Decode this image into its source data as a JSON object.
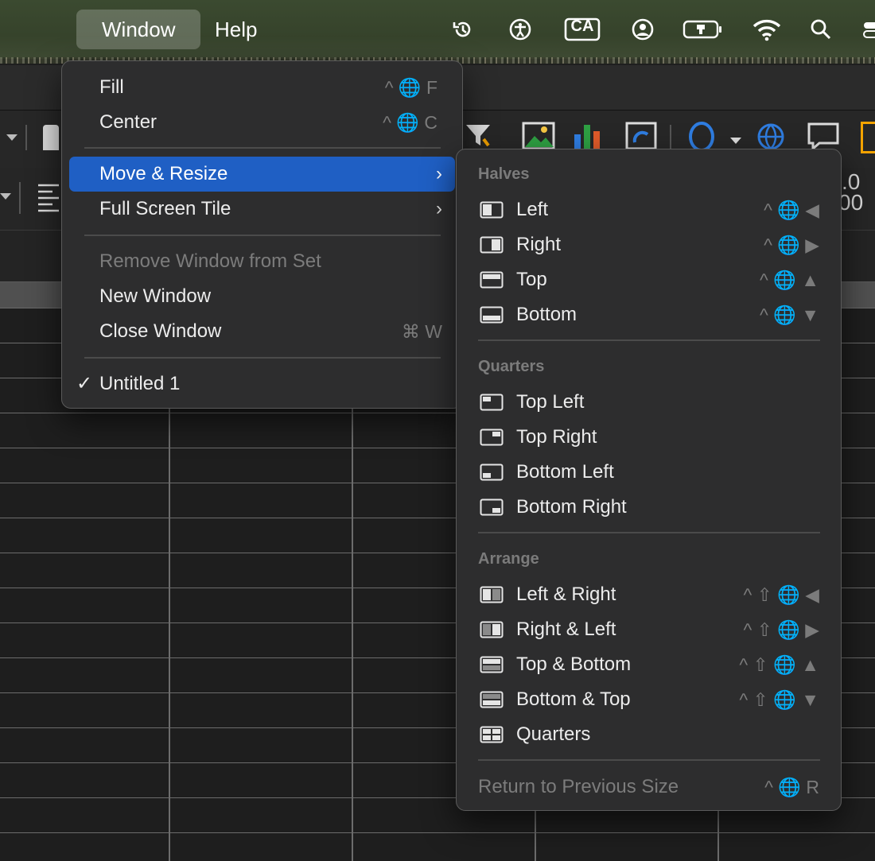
{
  "menubar": {
    "items": [
      {
        "label": "Window",
        "active": true
      },
      {
        "label": "Help",
        "active": false
      }
    ],
    "status_icons": [
      "time-machine-icon",
      "accessibility-icon",
      "input-source-icon",
      "user-account-icon",
      "battery-charging-icon",
      "wifi-icon",
      "spotlight-search-icon",
      "control-center-icon"
    ],
    "input_source_label": "CA"
  },
  "window_menu": {
    "items": [
      {
        "label": "Fill",
        "shortcut": "^ 🌐 F",
        "disabled": false
      },
      {
        "label": "Center",
        "shortcut": "^ 🌐 C",
        "disabled": false
      },
      {
        "label": "Move & Resize",
        "submenu": true,
        "highlighted": true
      },
      {
        "label": "Full Screen Tile",
        "submenu": true
      },
      {
        "label": "Remove Window from Set",
        "disabled": true
      },
      {
        "label": "New Window",
        "disabled": false
      },
      {
        "label": "Close Window",
        "shortcut": "⌘ W",
        "disabled": false
      },
      {
        "label": "Untitled 1",
        "checked": true
      }
    ],
    "submenu_chevron": "›",
    "check_mark": "✓"
  },
  "move_resize_menu": {
    "halves_title": "Halves",
    "halves": [
      {
        "label": "Left",
        "shortcut": "^ 🌐 ◀",
        "icon": "window-left-half-icon"
      },
      {
        "label": "Right",
        "shortcut": "^ 🌐 ▶",
        "icon": "window-right-half-icon"
      },
      {
        "label": "Top",
        "shortcut": "^ 🌐 ▲",
        "icon": "window-top-half-icon"
      },
      {
        "label": "Bottom",
        "shortcut": "^ 🌐 ▼",
        "icon": "window-bottom-half-icon"
      }
    ],
    "quarters_title": "Quarters",
    "quarters": [
      {
        "label": "Top Left",
        "icon": "window-top-left-icon"
      },
      {
        "label": "Top Right",
        "icon": "window-top-right-icon"
      },
      {
        "label": "Bottom Left",
        "icon": "window-bottom-left-icon"
      },
      {
        "label": "Bottom Right",
        "icon": "window-bottom-right-icon"
      }
    ],
    "arrange_title": "Arrange",
    "arrange": [
      {
        "label": "Left & Right",
        "shortcut": "^ ⇧ 🌐 ◀",
        "icon": "arrange-left-right-icon"
      },
      {
        "label": "Right & Left",
        "shortcut": "^ ⇧ 🌐 ▶",
        "icon": "arrange-right-left-icon"
      },
      {
        "label": "Top & Bottom",
        "shortcut": "^ ⇧ 🌐 ▲",
        "icon": "arrange-top-bottom-icon"
      },
      {
        "label": "Bottom & Top",
        "shortcut": "^ ⇧ 🌐 ▼",
        "icon": "arrange-bottom-top-icon"
      },
      {
        "label": "Quarters",
        "icon": "arrange-quarters-icon"
      }
    ],
    "return": {
      "label": "Return to Previous Size",
      "shortcut": "^ 🌐 R",
      "disabled": true
    }
  },
  "background_app": {
    "partial_text_top": ".0",
    "partial_text_bottom": "00"
  },
  "colors": {
    "menu_bg": "#2d2d2e",
    "highlight": "#1f5fc4",
    "disabled_text": "#7c7c7c"
  }
}
